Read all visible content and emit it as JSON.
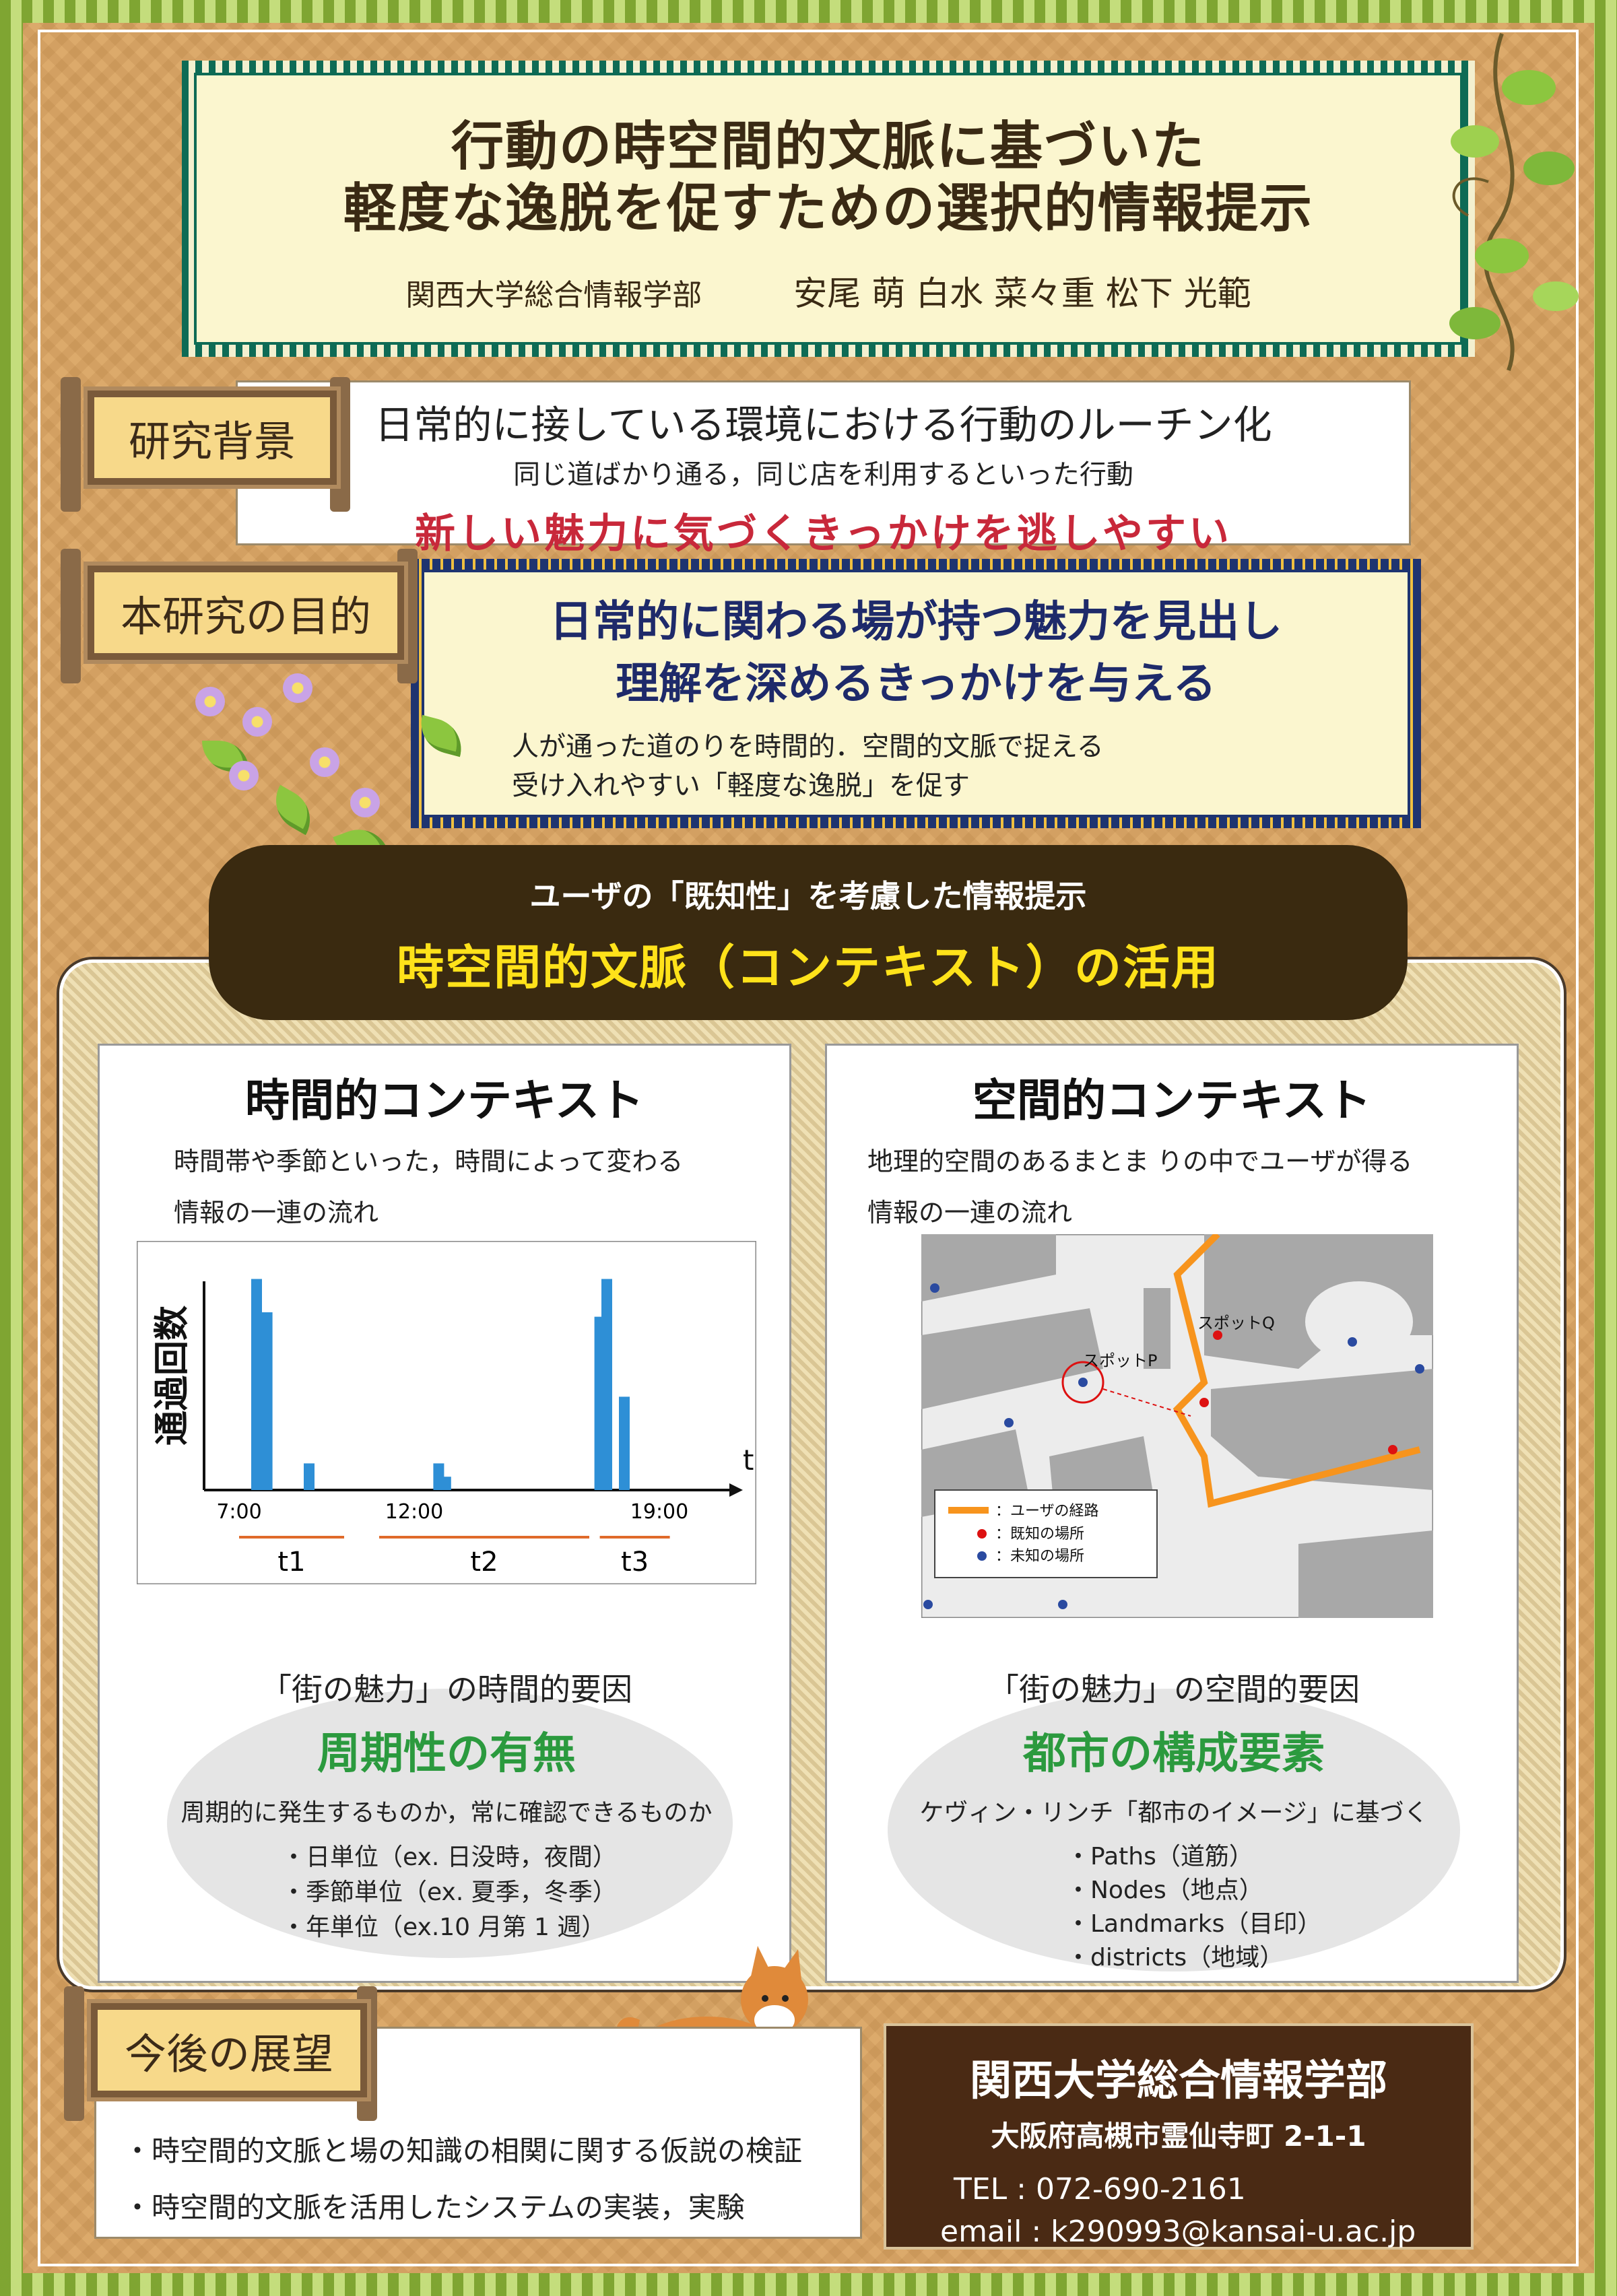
{
  "title": {
    "line1": "行動の時空間的文脈に基づいた",
    "line2": "軽度な逸脱を促すための選択的情報提示",
    "affiliation": "関西大学総合情報学部",
    "authors": "安尾 萌 白水 菜々重 松下 光範"
  },
  "background": {
    "label": "研究背景",
    "line1": "日常的に接している環境における行動のルーチン化",
    "line2": "同じ道ばかり通る，同じ店を利用するといった行動",
    "line3": "新しい魅力に気づくきっかけを逃しやすい"
  },
  "purpose": {
    "label": "本研究の目的",
    "line1": "日常的に関わる場が持つ魅力を見出し",
    "line2": "理解を深めるきっかけを与える",
    "line3": "人が通った道のりを時間的．空間的文脈で捉える",
    "line4": "受け入れやすい「軽度な逸脱」を促す"
  },
  "banner": {
    "sub": "ユーザの「既知性」を考慮した情報提示",
    "main": "時空間的文脈（コンテキスト）の活用"
  },
  "temporal": {
    "title": "時間的コンテキスト",
    "desc1": "時間帯や季節といった，時間によって変わる",
    "desc2": "情報の一連の流れ",
    "factor": "「街の魅力」の時間的要因",
    "heading": "周期性の有無",
    "note": "周期的に発生するものか，常に確認できるものか",
    "items": [
      "・日単位（ex. 日没時，夜間）",
      "・季節単位（ex. 夏季，冬季）",
      "・年単位（ex.10 月第 1 週）"
    ]
  },
  "spatial": {
    "title": "空間的コンテキスト",
    "desc1": "地理的空間のあるまとま りの中でユーザが得る",
    "desc2": "情報の一連の流れ",
    "factor": "「街の魅力」の空間的要因",
    "heading": "都市の構成要素",
    "note": "ケヴィン・リンチ「都市のイメージ」に基づく",
    "items": [
      "・Paths（道筋）",
      "・Nodes（地点）",
      "・Landmarks（目印）",
      "・districts（地域）"
    ],
    "map": {
      "spotP": "スポットP",
      "spotQ": "スポットQ",
      "legend_route": "：ユーザの経路",
      "legend_known": "：既知の場所",
      "legend_unknown": "：未知の場所"
    }
  },
  "chart_data": {
    "type": "bar",
    "ylabel": "通過回数",
    "xlabel": "t",
    "x_ticks": [
      "7:00",
      "12:00",
      "19:00"
    ],
    "intervals": [
      "t1",
      "t2",
      "t3"
    ],
    "series": [
      {
        "x": [
          7.5,
          7.8,
          9.0,
          12.7,
          12.9,
          17.3,
          17.5,
          18.0
        ],
        "values": [
          0.95,
          0.8,
          0.12,
          0.12,
          0.06,
          0.78,
          0.95,
          0.42
        ]
      }
    ],
    "xlim": [
      6,
      21
    ],
    "ylim": [
      0,
      1
    ],
    "colors": {
      "bar": "#2e8fd6",
      "interval": "#e06a2a"
    }
  },
  "future": {
    "label": "今後の展望",
    "items": [
      "・時空間的文脈と場の知識の相関に関する仮説の検証",
      "・時空間的文脈を活用したシステムの実装，実験"
    ]
  },
  "contact": {
    "org": "関西大学総合情報学部",
    "address": "大阪府高槻市霊仙寺町 2-1-1",
    "tel": "TEL : 072-690-2161",
    "email": "email : k290993@kansai-u.ac.jp"
  }
}
